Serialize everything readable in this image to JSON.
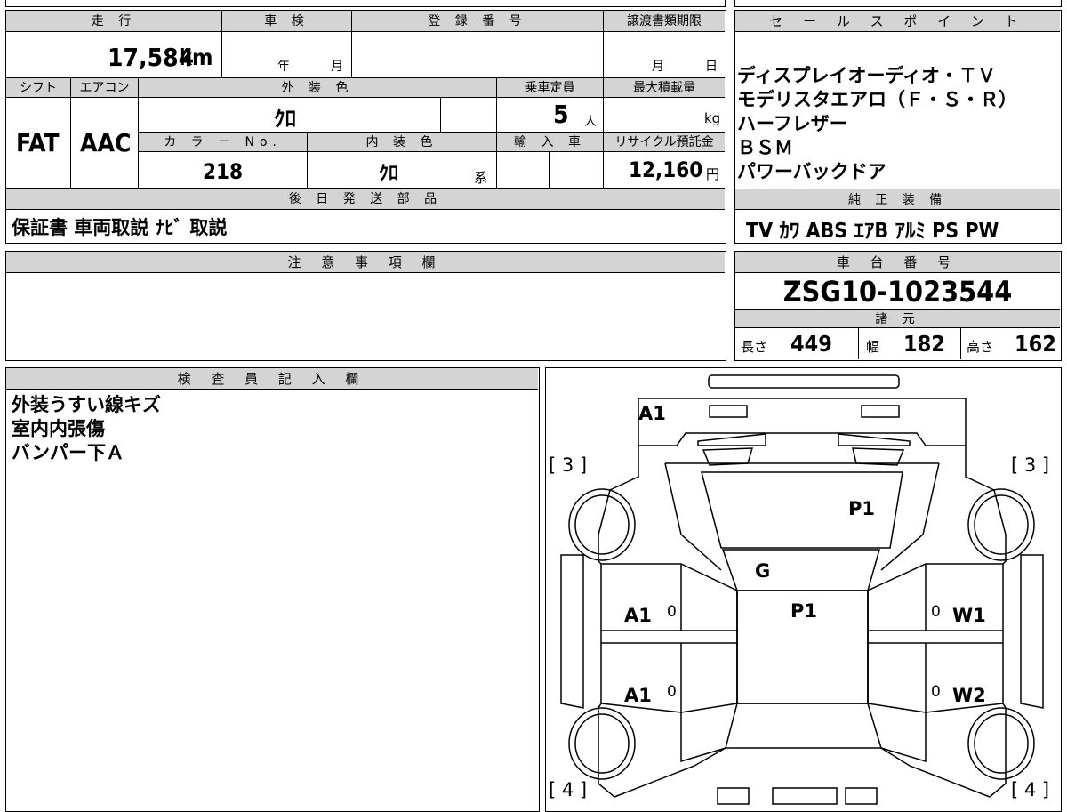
{
  "vehicle_table": {
    "mileage_label": "走 行",
    "mileage_value": "17,584",
    "mileage_unit": "km",
    "inspection_label": "車 検",
    "inspection_year": "年",
    "inspection_month": "月",
    "registration_label": "登 録 番 号",
    "registration_value": "",
    "transfer_label": "譲渡書類期限",
    "transfer_month": "月",
    "transfer_day": "日",
    "shift_label": "シフト",
    "shift_value": "FAT",
    "aircon_label": "エアコン",
    "aircon_value": "AAC",
    "exterior_color_label": "外 装 色",
    "exterior_color_value": "ｸﾛ",
    "capacity_label": "乗車定員",
    "capacity_value": "5",
    "capacity_unit": "人",
    "max_load_label": "最大積載量",
    "max_load_unit": "kg",
    "color_no_label": "カ ラ ー No.",
    "color_no_value": "218",
    "interior_color_label": "内 装 色",
    "interior_color_value": "ｸﾛ",
    "interior_color_suffix": "系",
    "import_label": "輸 入 車",
    "recycle_label": "リサイクル預託金",
    "recycle_value": "12,160",
    "recycle_unit": "円",
    "later_parts_label": "後 日 発 送 部 品",
    "later_parts_value": "保証書 車両取説 ﾅﾋﾞ 取説"
  },
  "sales_points": {
    "label": "セ ー ル ス ポ イ ン ト",
    "lines": [
      "ディスプレイオーディオ・ＴＶ",
      "モデリスタエアロ（Ｆ・Ｓ・Ｒ）",
      "ハーフレザー",
      "ＢＳＭ",
      "パワーバックドア"
    ]
  },
  "genuine_equipment": {
    "label": "純 正 装 備",
    "value": "TV ｶﾜ ABS ｴｱB ｱﾙﾐ PS PW"
  },
  "notes": {
    "label": "注 意 事 項 欄",
    "value": ""
  },
  "chassis": {
    "label": "車 台 番 号",
    "value": "ZSG10-1023544"
  },
  "specs": {
    "label": "諸 元",
    "length_label": "長さ",
    "length_value": "449",
    "width_label": "幅",
    "width_value": "182",
    "height_label": "高さ",
    "height_value": "162"
  },
  "inspector": {
    "label": "検 査 員 記 入 欄",
    "lines": [
      "外装うすい線キズ",
      "室内内張傷",
      "バンパー下Ａ"
    ]
  },
  "diagram": {
    "marks": {
      "front_bumper": "A1",
      "hood": "P1",
      "windshield": "G",
      "roof": "P1",
      "front_left_door": "A1",
      "rear_left_door": "A1",
      "front_right_door": "W1",
      "rear_right_door": "W2",
      "door_zero": "0"
    },
    "tire_front_left": "[ 3 ]",
    "tire_front_right": "[ 3 ]",
    "tire_rear_left": "[ 4 ]",
    "tire_rear_right": "[ 4 ]"
  }
}
